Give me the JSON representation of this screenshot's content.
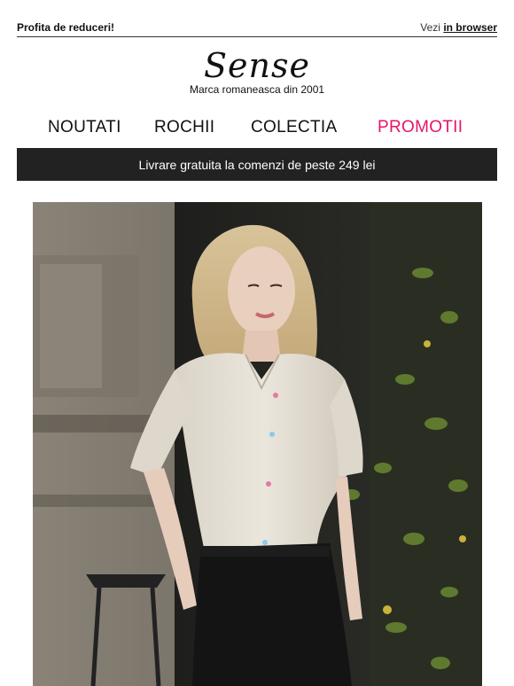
{
  "topbar": {
    "promo_label": "Profita de reduceri!",
    "view_prefix": "Vezi",
    "view_link": "in browser"
  },
  "brand": {
    "logo": "Sense",
    "tagline": "Marca romaneasca din 2001"
  },
  "nav": {
    "items": [
      {
        "label": "NOUTATI"
      },
      {
        "label": "ROCHII"
      },
      {
        "label": "COLECTIA"
      },
      {
        "label": "PROMOTII"
      }
    ],
    "highlight_color": "#e5146a"
  },
  "banner": {
    "text": "Livrare gratuita la comenzi de peste 249 lei"
  },
  "hero": {
    "image": "model-photo"
  }
}
